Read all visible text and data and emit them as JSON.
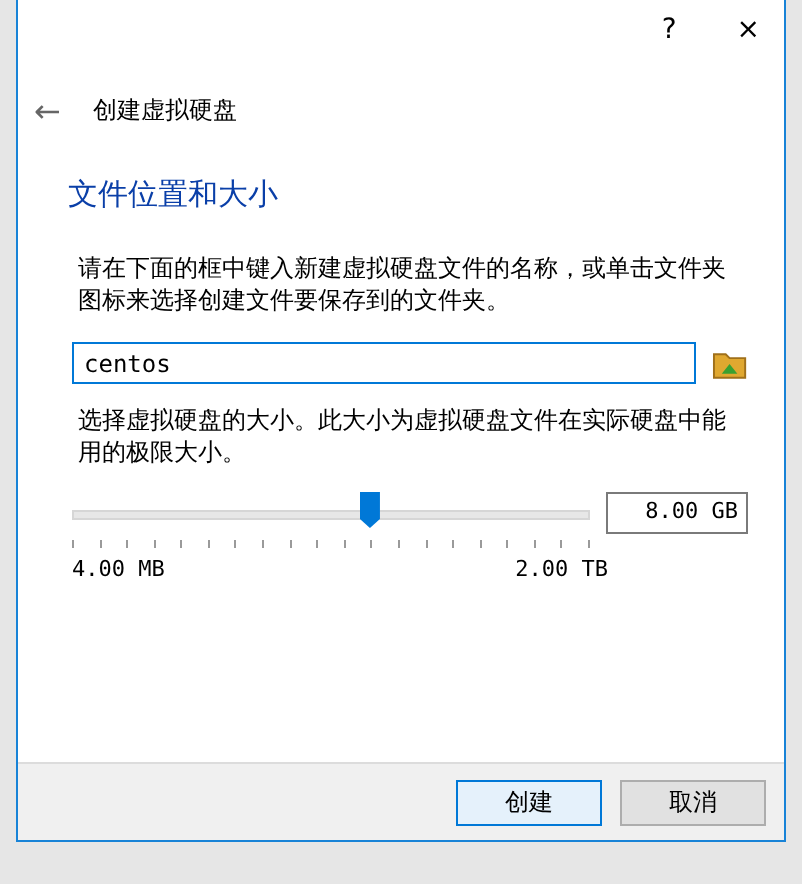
{
  "window": {
    "help": "?",
    "close": "×"
  },
  "header": {
    "back": "←",
    "title": "创建虚拟硬盘"
  },
  "section_title": "文件位置和大小",
  "location": {
    "description": "请在下面的框中键入新建虚拟硬盘文件的名称，或单击文件夹图标来选择创建文件要保存到的文件夹。",
    "value": "centos"
  },
  "size": {
    "description": "选择虚拟硬盘的大小。此大小为虚拟硬盘文件在实际硬盘中能用的极限大小。",
    "level": 0.575,
    "min_label": "4.00 MB",
    "max_label": "2.00 TB",
    "value": "8.00 GB"
  },
  "buttons": [
    {
      "label": "创建",
      "default": true
    },
    {
      "label": "取消",
      "default": false
    }
  ]
}
